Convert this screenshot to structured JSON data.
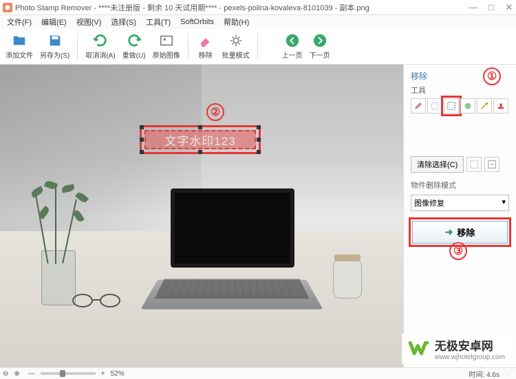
{
  "titlebar": {
    "app": "Photo Stamp Remover",
    "doc": "****未注册版 - 剩余 10 天试用期**** - pexels-polina-kovaleva-8101039 - 副本.png"
  },
  "menu": {
    "file": "文件(F)",
    "edit": "编辑(E)",
    "view": "视图(V)",
    "select": "选择(S)",
    "tools": "工具(T)",
    "softorbits": "SoftOrbits",
    "help": "帮助(H)"
  },
  "toolbar": {
    "add_file": "添加文件",
    "save_as": "另存为(S)",
    "undo": "取消消(A)",
    "redo": "重做(U)",
    "orig": "原始图像",
    "remove": "移除",
    "batch": "批量模式",
    "prev": "上一页",
    "next": "下一页"
  },
  "canvas": {
    "watermark_text": "文字水印123"
  },
  "callouts": {
    "c1": "①",
    "c2": "②",
    "c3": "③"
  },
  "side": {
    "header": "移除",
    "tools_label": "工具",
    "clear_sel": "清除选择(C)",
    "mode_label": "物件删除模式",
    "mode_value": "图像修复",
    "remove_btn": "移除"
  },
  "status": {
    "zoom_icon": "⊕⊖",
    "zoom_pct": "52%",
    "time_label": "时间:",
    "time_val": "4.6s"
  },
  "brand": {
    "name": "无极安卓网",
    "url": "www.wjhotelgroup.com"
  }
}
